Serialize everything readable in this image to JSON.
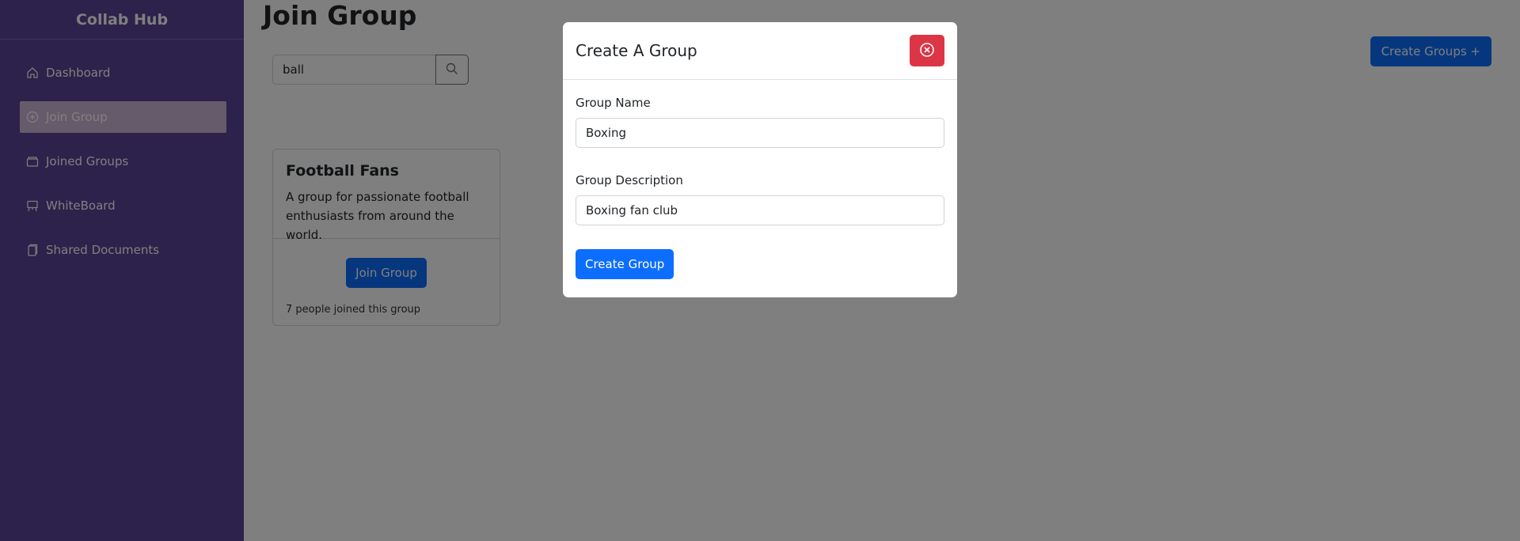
{
  "sidebar": {
    "brand": "Collab Hub",
    "items": [
      {
        "label": "Dashboard",
        "icon": "home-icon"
      },
      {
        "label": "Join Group",
        "icon": "plus-circle-icon",
        "active": true
      },
      {
        "label": "Joined Groups",
        "icon": "folder-icon"
      },
      {
        "label": "WhiteBoard",
        "icon": "easel-icon"
      },
      {
        "label": "Shared Documents",
        "icon": "documents-icon"
      }
    ]
  },
  "main": {
    "title": "Join Group",
    "search": {
      "value": "ball",
      "icon": "search-icon"
    },
    "create_groups_label": "Create Groups +",
    "group_card": {
      "title": "Football Fans",
      "description": "A group for passionate football enthusiasts from around the world.",
      "join_label": "Join Group",
      "joined_text": "7 people joined this group"
    }
  },
  "modal": {
    "title": "Create A Group",
    "close_icon": "close-circle-icon",
    "group_name_label": "Group Name",
    "group_name_value": "Boxing",
    "group_description_label": "Group Description",
    "group_description_value": "Boxing fan club",
    "submit_label": "Create Group"
  },
  "colors": {
    "sidebar": "#5a4497",
    "primary": "#0d6efd",
    "danger": "#dc3545"
  }
}
